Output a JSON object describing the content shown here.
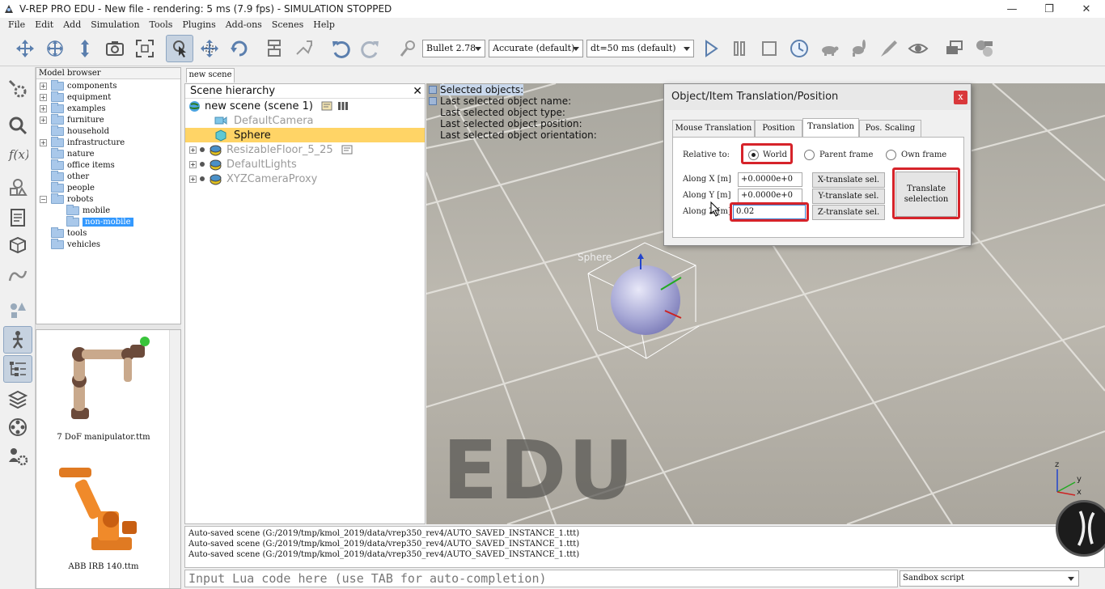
{
  "window": {
    "title": "V-REP PRO EDU - New file - rendering: 5 ms (7.9 fps) - SIMULATION STOPPED",
    "minimize": "—",
    "restore": "❐",
    "close": "✕"
  },
  "menu": [
    "File",
    "Edit",
    "Add",
    "Simulation",
    "Tools",
    "Plugins",
    "Add-ons",
    "Scenes",
    "Help"
  ],
  "toolbar": {
    "engine": "Bullet 2.78",
    "accuracy": "Accurate (default)",
    "timestep": "dt=50 ms (default)"
  },
  "model_browser": {
    "header": "Model browser",
    "items": [
      {
        "label": "components",
        "expandable": true
      },
      {
        "label": "equipment",
        "expandable": true
      },
      {
        "label": "examples",
        "expandable": true
      },
      {
        "label": "furniture",
        "expandable": true
      },
      {
        "label": "household",
        "expandable": false
      },
      {
        "label": "infrastructure",
        "expandable": true
      },
      {
        "label": "nature",
        "expandable": false
      },
      {
        "label": "office items",
        "expandable": false
      },
      {
        "label": "other",
        "expandable": false
      },
      {
        "label": "people",
        "expandable": false
      },
      {
        "label": "robots",
        "expandable": true
      },
      {
        "label": "mobile",
        "expandable": false
      },
      {
        "label": "non-mobile",
        "expandable": false
      },
      {
        "label": "tools",
        "expandable": false
      },
      {
        "label": "vehicles",
        "expandable": false
      }
    ]
  },
  "model_thumbs": [
    "7 DoF manipulator.ttm",
    "ABB IRB 140.ttm"
  ],
  "scene_tab": "new scene",
  "hierarchy": {
    "header": "Scene hierarchy",
    "close": "✕",
    "rows": [
      {
        "label": "new scene (scene 1)"
      },
      {
        "label": "DefaultCamera"
      },
      {
        "label": "Sphere"
      },
      {
        "label": "ResizableFloor_5_25"
      },
      {
        "label": "DefaultLights"
      },
      {
        "label": "XYZCameraProxy"
      }
    ]
  },
  "viewport": {
    "info": [
      "Selected objects:",
      "Last selected object name:",
      "Last selected object type:",
      "Last selected object position:",
      "Last selected object orientation:"
    ],
    "watermark": "EDU",
    "sphere_label": "Sphere",
    "axes": {
      "x": "x",
      "y": "y",
      "z": "z"
    }
  },
  "dialog": {
    "title": "Object/Item Translation/Position",
    "close": "x",
    "tabs": [
      "Mouse Translation",
      "Position",
      "Translation",
      "Pos. Scaling"
    ],
    "active_tab": "Translation",
    "relative_to_label": "Relative to:",
    "relative_options": [
      "World",
      "Parent frame",
      "Own frame"
    ],
    "relative_selected": "World",
    "along_x_label": "Along X [m]",
    "along_y_label": "Along Y [m]",
    "along_z_label": "Along Z [m]",
    "along_x_value": "+0.0000e+0",
    "along_y_value": "+0.0000e+0",
    "along_z_value": "0.02",
    "x_button": "X-translate sel.",
    "y_button": "Y-translate sel.",
    "z_button": "Z-translate sel.",
    "translate_button_line1": "Translate",
    "translate_button_line2": "selelection",
    "highlight_color": "#d6232a"
  },
  "console": [
    "Auto-saved scene (G:/2019/tmp/kmol_2019/data/vrep350_rev4/AUTO_SAVED_INSTANCE_1.ttt)",
    "Auto-saved scene (G:/2019/tmp/kmol_2019/data/vrep350_rev4/AUTO_SAVED_INSTANCE_1.ttt)",
    "Auto-saved scene (G:/2019/tmp/kmol_2019/data/vrep350_rev4/AUTO_SAVED_INSTANCE_1.ttt)"
  ],
  "lua_input": {
    "placeholder": "Input Lua code here (use TAB for auto-completion)"
  },
  "script_type": "Sandbox script"
}
